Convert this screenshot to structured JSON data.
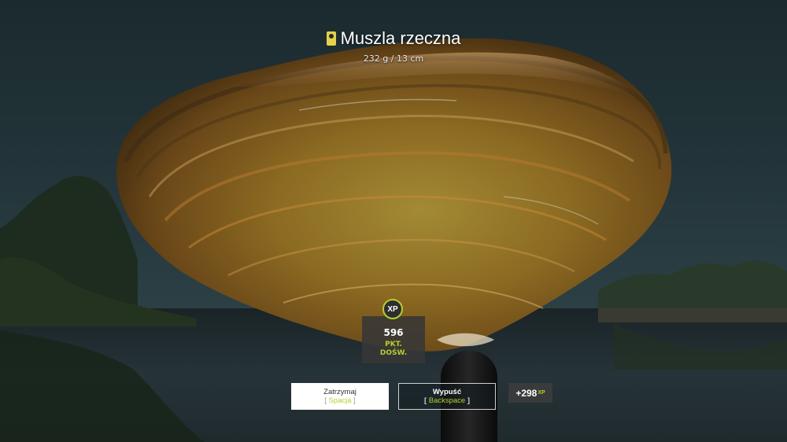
{
  "catch": {
    "name": "Muszla rzeczna",
    "stats": "232 g  /  13 cm",
    "icon": "trophy-marker-icon"
  },
  "xp": {
    "badge": "XP",
    "value": "596",
    "label_line1": "PKT.",
    "label_line2": "DOŚW."
  },
  "actions": {
    "keep_label": "Zatrzymaj",
    "keep_key": "Spacja",
    "release_label": "Wypuść",
    "release_key": "Backspace"
  },
  "gain": {
    "value": "+298",
    "unit": "XP"
  },
  "colors": {
    "accent": "#b6d02c",
    "trophy": "#e4d24a"
  }
}
